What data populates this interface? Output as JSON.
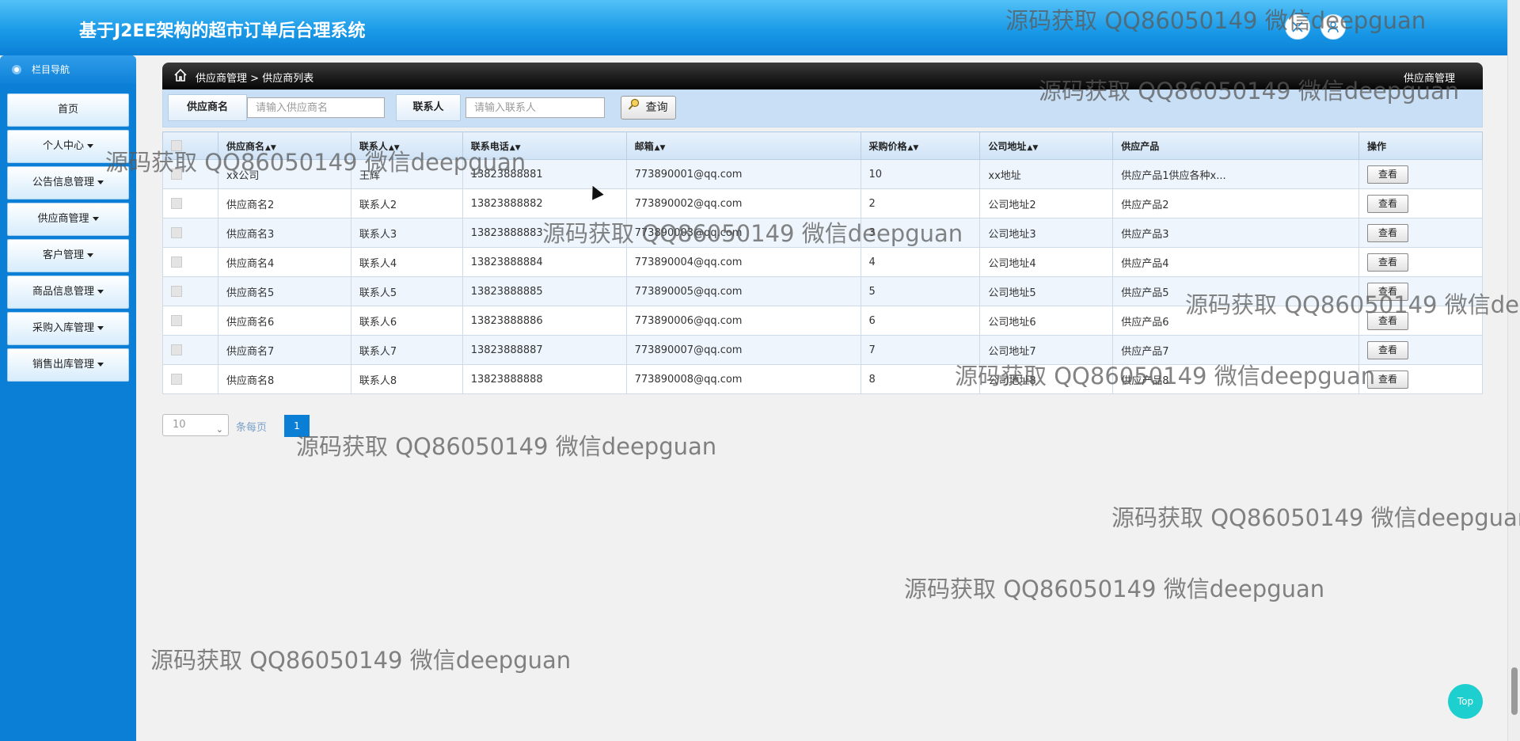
{
  "app": {
    "title": "基于J2EE架构的超市订单后台理系统"
  },
  "sidebar": {
    "header": "栏目导航",
    "items": [
      {
        "label": "首页",
        "dropdown": false
      },
      {
        "label": "个人中心",
        "dropdown": true
      },
      {
        "label": "公告信息管理",
        "dropdown": true
      },
      {
        "label": "供应商管理",
        "dropdown": true
      },
      {
        "label": "客户管理",
        "dropdown": true
      },
      {
        "label": "商品信息管理",
        "dropdown": true
      },
      {
        "label": "采购入库管理",
        "dropdown": true
      },
      {
        "label": "销售出库管理",
        "dropdown": true
      }
    ]
  },
  "breadcrumb": {
    "parent": "供应商管理",
    "separator": ">",
    "current": "供应商列表",
    "right_title": "供应商管理"
  },
  "search": {
    "name_label": "供应商名",
    "name_placeholder": "请输入供应商名",
    "contact_label": "联系人",
    "contact_placeholder": "请输入联系人",
    "button_label": "查询"
  },
  "table": {
    "headers": [
      "供应商名",
      "联系人",
      "联系电话",
      "邮箱",
      "采购价格",
      "公司地址",
      "供应产品",
      "操作"
    ],
    "rows": [
      [
        "xx公司",
        "王辉",
        "13823888881",
        "773890001@qq.com",
        "10",
        "xx地址",
        "供应产品1供应各种x..."
      ],
      [
        "供应商名2",
        "联系人2",
        "13823888882",
        "773890002@qq.com",
        "2",
        "公司地址2",
        "供应产品2"
      ],
      [
        "供应商名3",
        "联系人3",
        "13823888883",
        "773890003@qq.com",
        "3",
        "公司地址3",
        "供应产品3"
      ],
      [
        "供应商名4",
        "联系人4",
        "13823888884",
        "773890004@qq.com",
        "4",
        "公司地址4",
        "供应产品4"
      ],
      [
        "供应商名5",
        "联系人5",
        "13823888885",
        "773890005@qq.com",
        "5",
        "公司地址5",
        "供应产品5"
      ],
      [
        "供应商名6",
        "联系人6",
        "13823888886",
        "773890006@qq.com",
        "6",
        "公司地址6",
        "供应产品6"
      ],
      [
        "供应商名7",
        "联系人7",
        "13823888887",
        "773890007@qq.com",
        "7",
        "公司地址7",
        "供应产品7"
      ],
      [
        "供应商名8",
        "联系人8",
        "13823888888",
        "773890008@qq.com",
        "8",
        "公司地址8",
        "供应产品8"
      ]
    ],
    "view_label": "查看"
  },
  "pager": {
    "page_size": "10",
    "per_page_label": "条每页",
    "current_page": "1"
  },
  "top_button": "Top",
  "watermark": "源码获取 QQ86050149 微信deepguan",
  "icons": {
    "header_left": "shrink-icon",
    "header_right": "user-icon",
    "breadcrumb": "home-icon",
    "search": "magnifier-icon"
  },
  "colors": {
    "header": "#1a9ae8",
    "sidebar": "#0b7fd6",
    "page_active": "#0b7fd6",
    "top_button": "#1ecfcf"
  }
}
